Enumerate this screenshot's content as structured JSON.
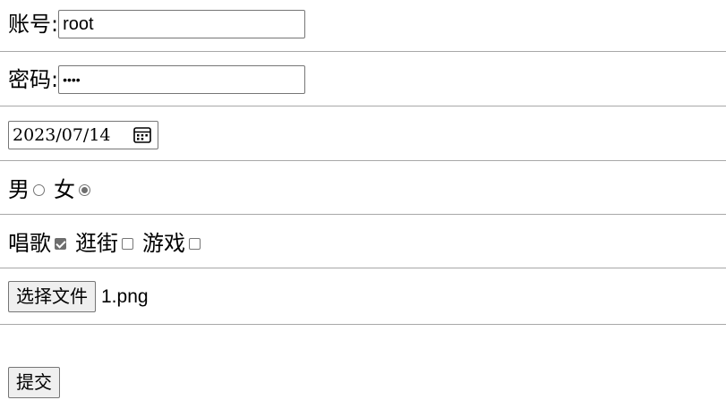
{
  "account": {
    "label": "账号:",
    "value": "root"
  },
  "password": {
    "label": "密码:",
    "masked_value": "••••"
  },
  "date": {
    "value": "2023/07/14",
    "icon": "calendar-icon"
  },
  "gender": {
    "options": [
      {
        "label": "男",
        "checked": false
      },
      {
        "label": "女",
        "checked": true
      }
    ]
  },
  "hobbies": {
    "options": [
      {
        "label": "唱歌",
        "checked": true
      },
      {
        "label": "逛街",
        "checked": false
      },
      {
        "label": "游戏",
        "checked": false
      }
    ]
  },
  "file": {
    "button_label": "选择文件",
    "file_name": "1.png"
  },
  "submit": {
    "label": "提交"
  }
}
